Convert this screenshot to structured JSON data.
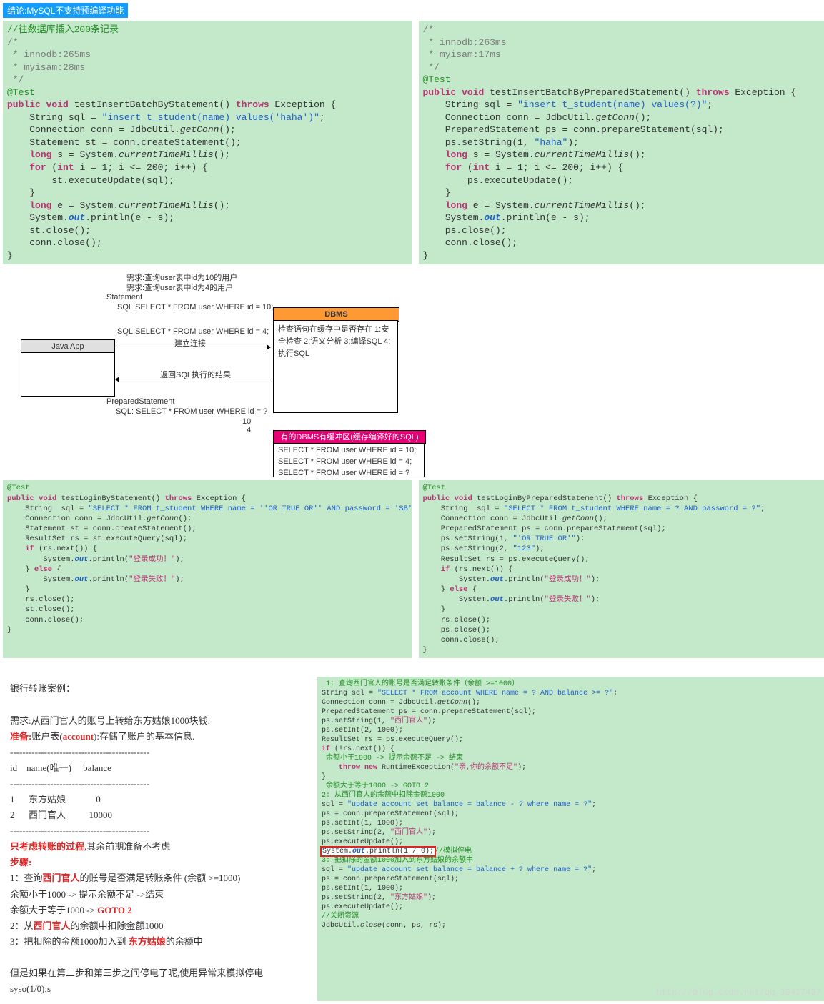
{
  "header": {
    "tag": "结论:MySQL不支持预编译功能"
  },
  "code1_left": "//往数据库插入200条记录\n/*\n * innodb:265ms\n * myisam:28ms\n */\n@Test\npublic void testInsertBatchByStatement() throws Exception {\n    String sql = \"insert t_student(name) values('haha')\";\n    Connection conn = JdbcUtil.getConn();\n    Statement st = conn.createStatement();\n    long s = System.currentTimeMillis();\n    for (int i = 1; i <= 200; i++) {\n        st.executeUpdate(sql);\n    }\n    long e = System.currentTimeMillis();\n    System.out.println(e - s);\n    st.close();\n    conn.close();\n}",
  "code1_right": "/*\n * innodb:263ms\n * myisam:17ms\n */\n@Test\npublic void testInsertBatchByPreparedStatement() throws Exception {\n    String sql = \"insert t_student(name) values(?)\";\n    Connection conn = JdbcUtil.getConn();\n    PreparedStatement ps = conn.prepareStatement(sql);\n    ps.setString(1, \"haha\");\n    long s = System.currentTimeMillis();\n    for (int i = 1; i <= 200; i++) {\n        ps.executeUpdate();\n    }\n    long e = System.currentTimeMillis();\n    System.out.println(e - s);\n    ps.close();\n    conn.close();\n}",
  "diagram": {
    "req1": "需求:查询user表中id为10的用户",
    "req2": "需求:查询user表中id为4的用户",
    "stmt_head": "Statement",
    "sql1": "SQL:SELECT * FROM user WHERE id = 10;",
    "sql2": "SQL:SELECT * FROM user WHERE id = 4;",
    "javaapp": "Java App",
    "connect": "建立连接",
    "return": "返回SQL执行的结果",
    "pstmt_head": "PreparedStatement",
    "psql": "SQL: SELECT * FROM user WHERE id = ?",
    "vals": "10\n4",
    "dbms_title": "DBMS",
    "dbms_body": "检查语句在缓存中是否存在\n1:安全检查\n\n2:语义分析\n\n3:编译SQL\n\n4:执行SQL",
    "cache_title": "有的DBMS有缓冲区(缓存编译好的SQL)",
    "cache_body": "SELECT * FROM user WHERE id = 10;\nSELECT * FROM user WHERE id = 4;\nSELECT * FROM user WHERE id = ?"
  },
  "code2_left": "@Test\npublic void testLoginByStatement() throws Exception {\n    String  sql = \"SELECT * FROM t_student WHERE name = ''OR TRUE OR'' AND password = 'SB'\";\n    Connection conn = JdbcUtil.getConn();\n    Statement st = conn.createStatement();\n    ResultSet rs = st.executeQuery(sql);\n    if (rs.next()) {\n        System.out.println(\"登录成功！\");\n    } else {\n        System.out.println(\"登录失败！\");\n    }\n    rs.close();\n    st.close();\n    conn.close();\n}",
  "code2_right": "@Test\npublic void testLoginByPreparedStatement() throws Exception {\n    String  sql = \"SELECT * FROM t_student WHERE name = ? AND password = ?\";\n    Connection conn = JdbcUtil.getConn();\n    PreparedStatement ps = conn.prepareStatement(sql);\n    ps.setString(1, \"'OR TRUE OR'\");\n    ps.setString(2, \"123\");\n    ResultSet rs = ps.executeQuery();\n    if (rs.next()) {\n        System.out.println(\"登录成功！\");\n    } else {\n        System.out.println(\"登录失败！\");\n    }\n    rs.close();\n    ps.close();\n    conn.close();\n}",
  "doc": {
    "title": "银行转账案例：",
    "need": "需求:从西门官人的账号上转给东方姑娘1000块钱.",
    "prep_k": "准备:",
    "prep1": "账户表(",
    "account": "account",
    "prep2": "):存储了账户的基本信息.",
    "dash": "---------------------------------------------",
    "th": "id    name(唯一)     balance",
    "r1": "1      东方姑娘             0",
    "r2": "2      西门官人          10000",
    "only1": "只考虑转账的过程",
    "only2": ",其余前期准备不考虑",
    "steps": "步骤:",
    "s1a": "  1：查询",
    "s1name": "西门官人",
    "s1b": "的账号是否满足转账条件 (余额 >=1000)",
    "s1c": "       余额小于1000 -> 提示余额不足 ->结束",
    "s1d": "       余额大于等于1000 -> ",
    "goto2": "GOTO 2",
    "s2a": "  2：从",
    "s2b": "的余额中扣除金额1000",
    "s3a": "  3：把扣除的金额1000加入到 ",
    "s3name": "东方姑娘",
    "s3b": "的余额中",
    "tail1": "但是如果在第二步和第三步之间停电了呢,使用异常来模拟停电",
    "tail2": "syso(1/0);s"
  },
  "code3": {
    "c1": " 1: 查询西门官人的账号是否满足转账条件（余额 >=1000）",
    "l2a": "String sql = ",
    "l2b": "\"SELECT * FROM account WHERE name = ? AND balance >= ?\"",
    "l2c": ";",
    "l3a": "Connection conn = JdbcUtil.",
    "l3b": "getConn",
    "l3c": "();",
    "l4": "PreparedStatement ps = conn.prepareStatement(sql);",
    "l5a": "ps.setString(1, ",
    "l5b": "\"西门官人\"",
    "l5c": ");",
    "l6": "ps.setInt(2, 1000);",
    "l7": "ResultSet rs = ps.executeQuery();",
    "l8a": "if",
    "l8b": " (!rs.next()) {",
    "c9": " 余额小于1000 -> 提示余额不足 -> 结束",
    "l10a": "    throw new",
    "l10b": " RuntimeException(",
    "l10c": "\"亲,你的余额不足\"",
    "l10d": ");",
    "l11": "}",
    "c12": " 余额大于等于1000 -> GOTO 2",
    "c13": "2: 从西门官人的余额中扣除金额1000",
    "l14a": "sql = ",
    "l14b": "\"update account set balance = balance - ? where name = ?\"",
    "l14c": ";",
    "l15": "ps = conn.prepareStatement(sql);",
    "l16": "ps.setInt(1, 1000);",
    "l17a": "ps.setString(2, ",
    "l17b": "\"西门官人\"",
    "l17c": ");",
    "l18": "ps.executeUpdate();",
    "l19a": "System.",
    "l19b": "out",
    "l19c": ".println(1 / 0);",
    "l19d": "//模拟停电",
    "c20": "3: 把扣除的金额1000加入到东方姑娘的余额中",
    "l21a": "sql = ",
    "l21b": "\"update account set balance = balance + ? where name = ?\"",
    "l21c": ";",
    "l22": "ps = conn.prepareStatement(sql);",
    "l23": "ps.setInt(1, 1000);",
    "l24a": "ps.setString(2, ",
    "l24b": "\"东方姑娘\"",
    "l24c": ");",
    "l25": "ps.executeUpdate();",
    "c26": "//关闭资源",
    "l27a": "JdbcUtil.",
    "l27b": "close",
    "l27c": "(conn, ps, rs);"
  },
  "watermark": "http://blog.csdn.net/qq_35427437"
}
